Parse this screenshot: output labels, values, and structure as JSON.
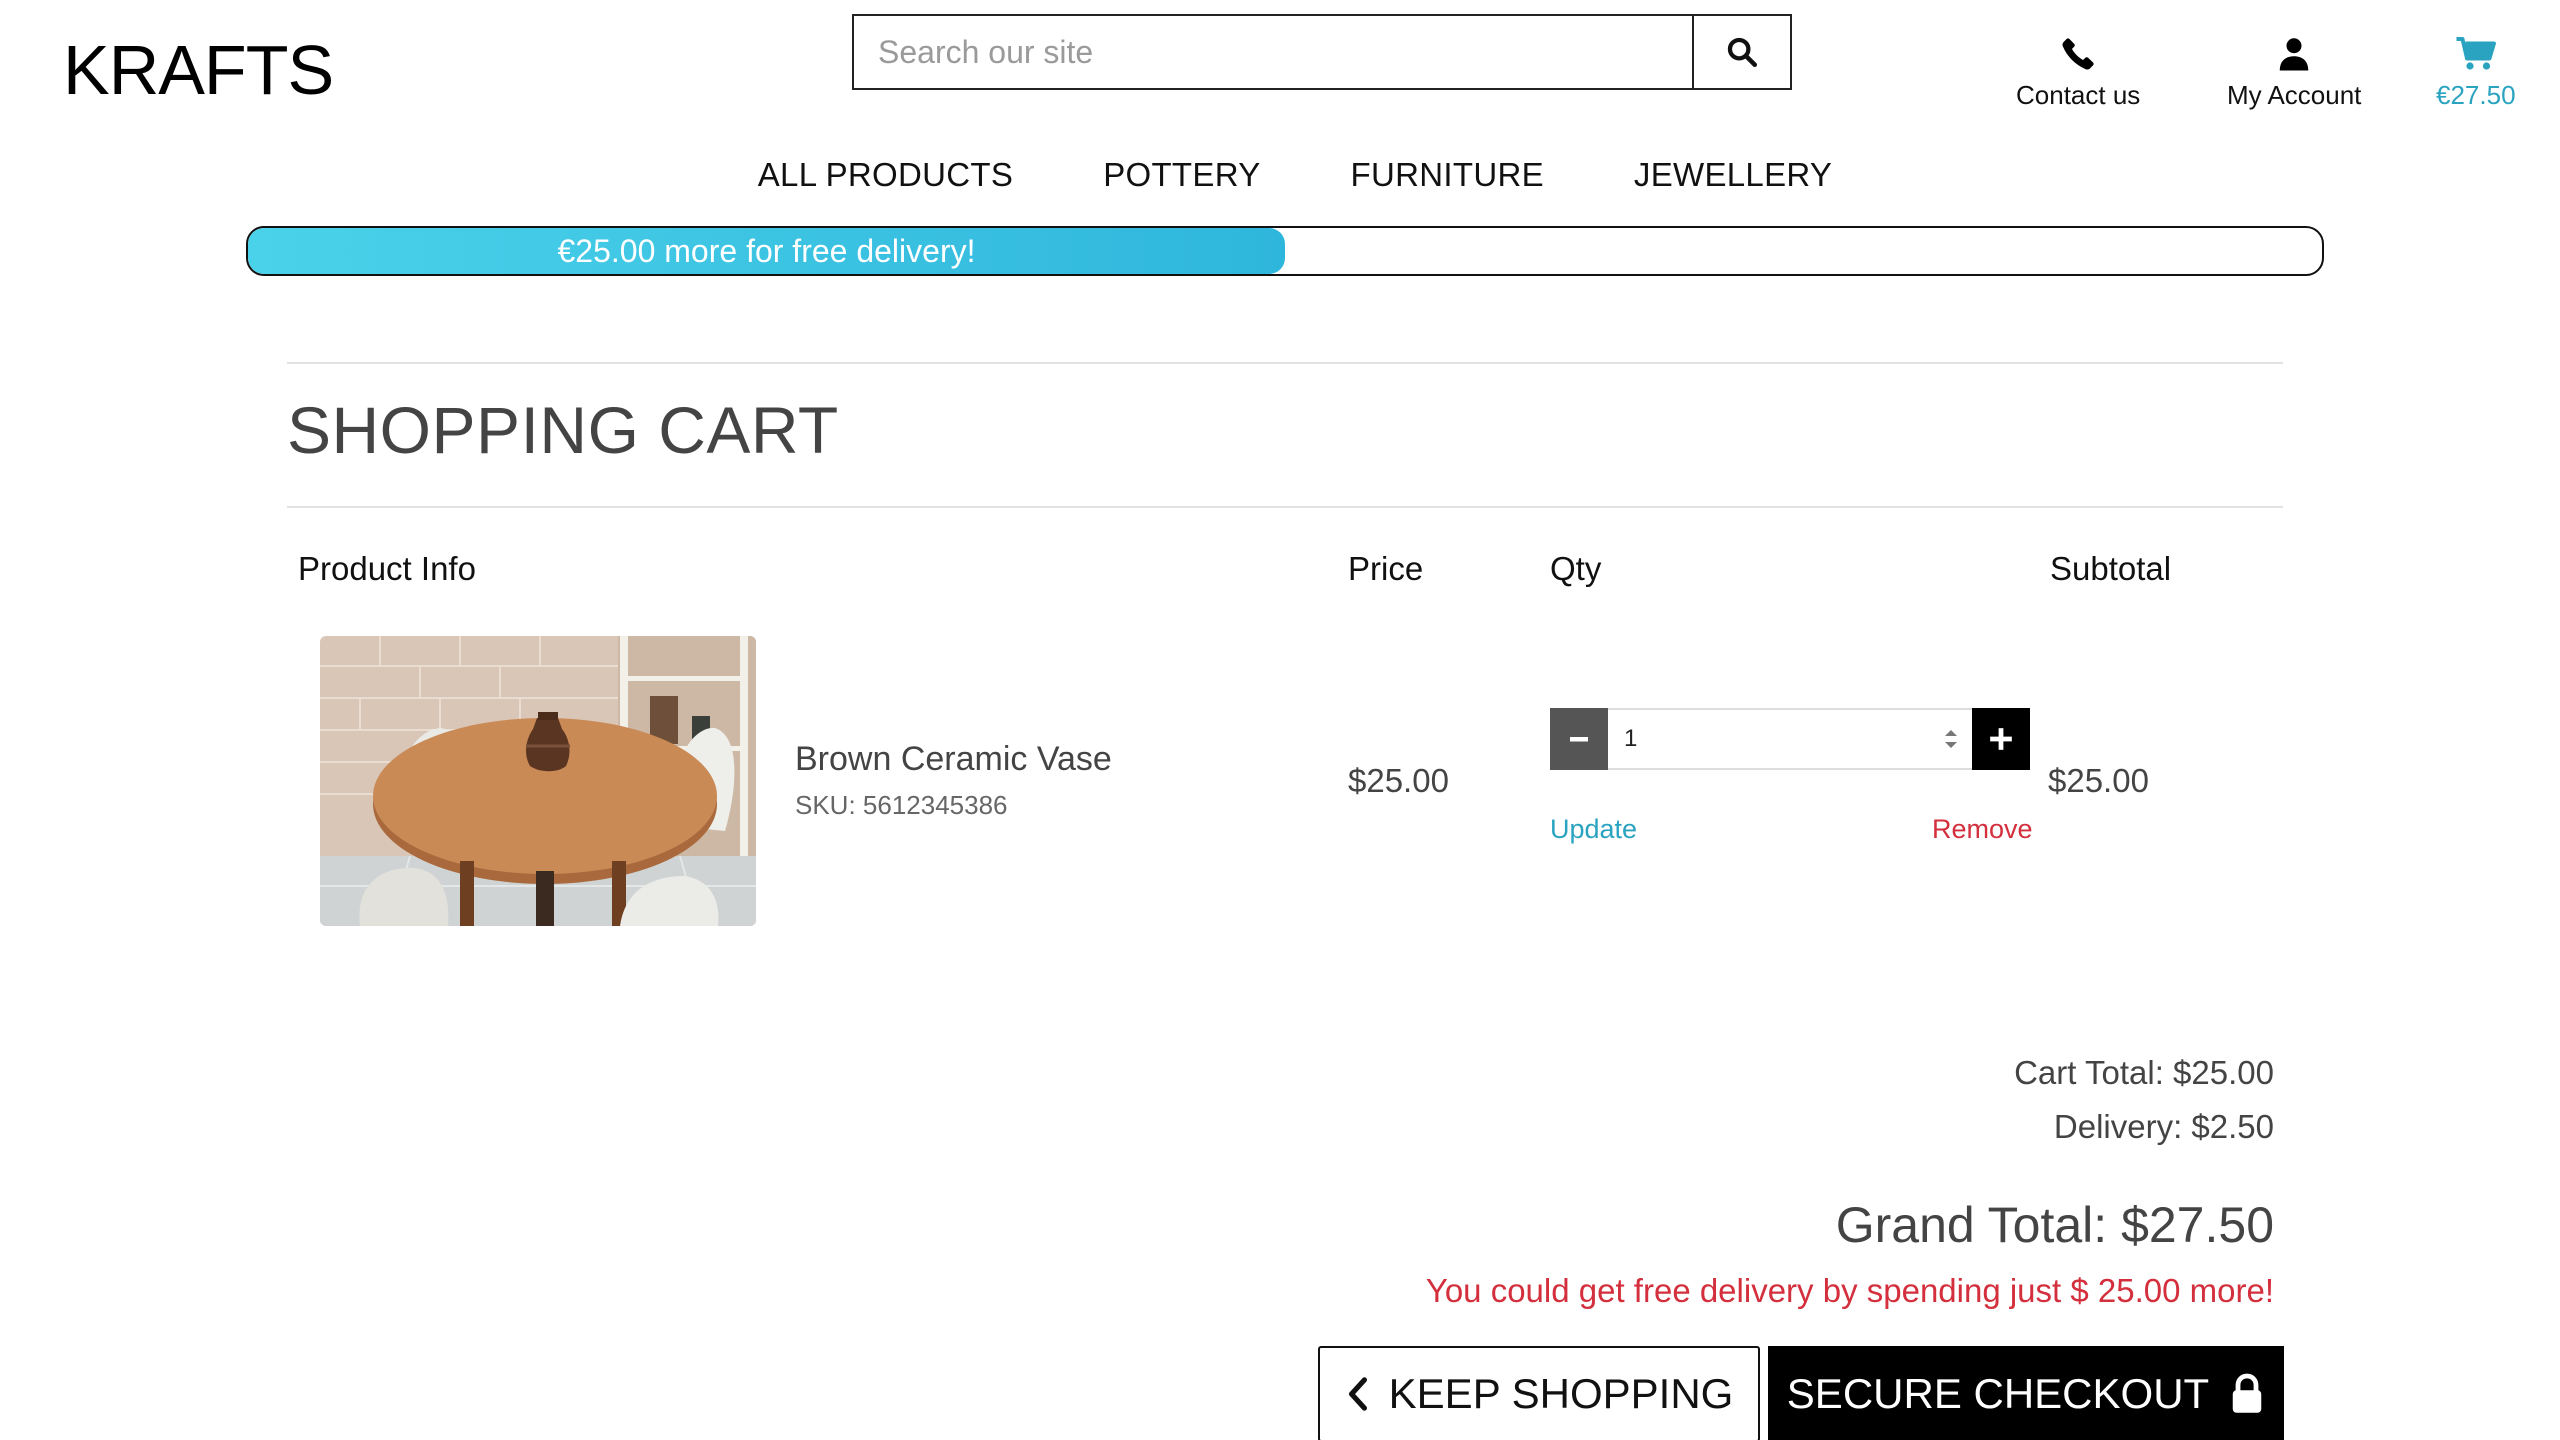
{
  "header": {
    "logo": "KRAFTS",
    "search": {
      "placeholder": "Search our site",
      "value": ""
    },
    "contact_label": "Contact us",
    "account_label": "My Account",
    "cart_total": "€27.50"
  },
  "nav": {
    "items": [
      {
        "label": "ALL PRODUCTS"
      },
      {
        "label": "POTTERY"
      },
      {
        "label": "FURNITURE"
      },
      {
        "label": "JEWELLERY"
      }
    ]
  },
  "delivery_banner": {
    "text": "€25.00 more for free delivery!",
    "progress": 0.5
  },
  "cart": {
    "title": "SHOPPING CART",
    "columns": {
      "product": "Product Info",
      "price": "Price",
      "qty": "Qty",
      "subtotal": "Subtotal"
    },
    "items": [
      {
        "name": "Brown Ceramic Vase",
        "sku": "SKU: 5612345386",
        "price": "$25.00",
        "quantity": "1",
        "subtotal": "$25.00",
        "update_label": "Update",
        "remove_label": "Remove"
      }
    ]
  },
  "totals": {
    "cart_total": "Cart Total: $25.00",
    "delivery": "Delivery: $2.50",
    "grand_total": "Grand Total: $27.50",
    "free_delivery_msg": "You could get free delivery by spending just $ 25.00 more!"
  },
  "buttons": {
    "keep_shopping": "KEEP SHOPPING",
    "secure_checkout": "SECURE CHECKOUT"
  },
  "colors": {
    "accent": "#2aa3c0",
    "danger": "#d32f3c",
    "progress_start": "#4ad2ea",
    "progress_end": "#2fb6dc"
  },
  "icons": {
    "search": "search-icon",
    "contact": "phone-icon",
    "account": "user-icon",
    "cart": "cart-icon",
    "minus": "minus-icon",
    "plus": "plus-icon",
    "back": "chevron-left-icon",
    "lock": "lock-icon"
  }
}
